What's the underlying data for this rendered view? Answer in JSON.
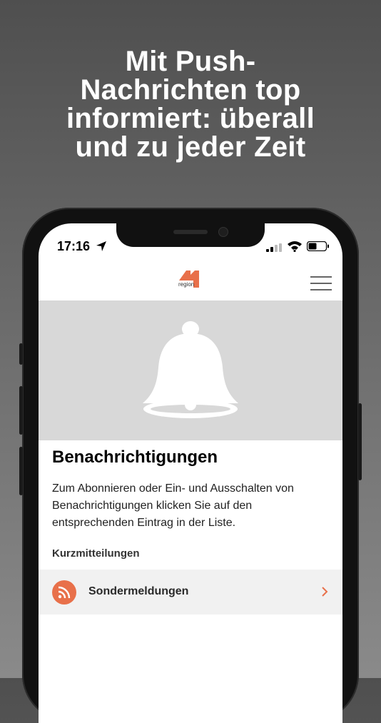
{
  "headline": "Mit Push-\nNachrichten top\ninformiert: überall\nund zu jeder Zeit",
  "status_bar": {
    "time": "17:16"
  },
  "app_bar": {
    "logo_text": "region"
  },
  "content": {
    "title": "Benachrichtigungen",
    "description": "Zum Abonnieren oder Ein- und Ausschalten von Benachrichtigungen klicken Sie auf den entsprechenden Eintrag in der Liste.",
    "section_label": "Kurzmitteilungen",
    "list": [
      {
        "label": "Sondermeldungen",
        "icon": "rss-icon"
      }
    ]
  },
  "colors": {
    "accent": "#e8704a",
    "hero_bg": "#d8d8d8",
    "row_bg": "#f1f1f1"
  }
}
